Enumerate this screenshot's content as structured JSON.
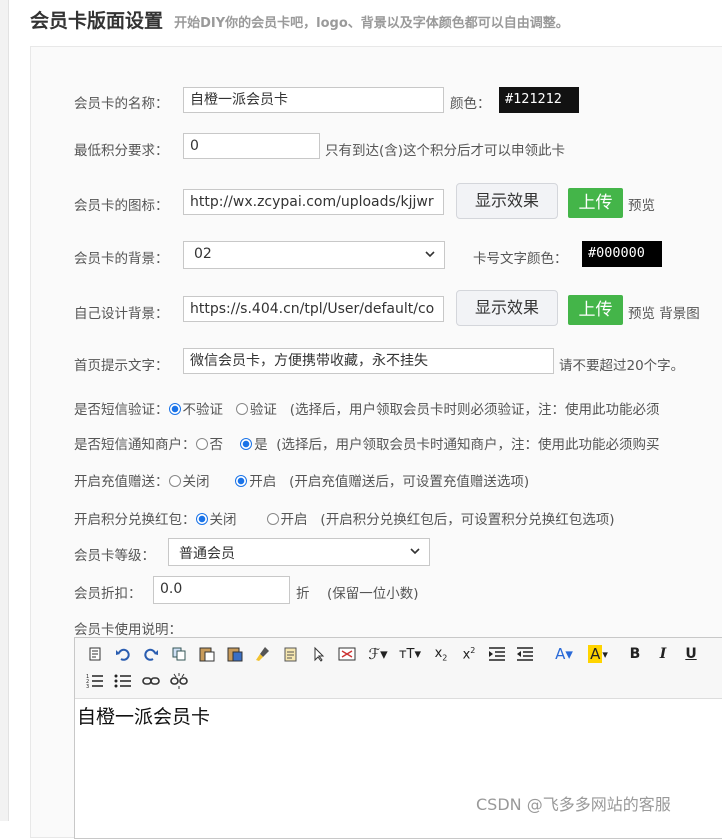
{
  "header": {
    "title": "会员卡版面设置",
    "subtitle": "开始DIY你的会员卡吧，logo、背景以及字体颜色都可以自由调整。"
  },
  "form": {
    "name_label": "会员卡的名称：",
    "name_value": "自橙一派会员卡",
    "color_label": "颜色：",
    "color_value": "#121212",
    "minpoints_label": "最低积分要求：",
    "minpoints_value": "0",
    "minpoints_hint": "只有到达(含)这个积分后才可以申领此卡",
    "icon_label": "会员卡的图标：",
    "icon_value": "http://wx.zcypai.com/uploads/kjjwr",
    "show_effect": "显示效果",
    "upload": "上传",
    "preview": "预览",
    "bg_label": "会员卡的背景：",
    "bg_value": "02",
    "cardno_color_label": "卡号文字颜色：",
    "cardno_color_value": "#000000",
    "custom_bg_label": "自己设计背景：",
    "custom_bg_value": "https://s.404.cn/tpl/User/default/co",
    "preview_bg": "预览 背景图",
    "tip_label": "首页提示文字：",
    "tip_value": "微信会员卡，方便携带收藏，永不挂失",
    "tip_hint": "请不要超过20个字。",
    "sms_verify_label": "是否短信验证：",
    "sms_verify_opt1": "不验证",
    "sms_verify_opt2": "验证",
    "sms_verify_hint": "(选择后，用户领取会员卡时则必须验证，注：使用此功能必须",
    "sms_notify_label": "是否短信通知商户：",
    "sms_notify_opt1": "否",
    "sms_notify_opt2": "是",
    "sms_notify_hint": "(选择后，用户领取会员卡时通知商户，注：使用此功能必须购买",
    "recharge_label": "开启充值赠送：",
    "recharge_opt1": "关闭",
    "recharge_opt2": "开启",
    "recharge_hint": "(开启充值赠送后，可设置充值赠送选项)",
    "redpack_label": "开启积分兑换红包：",
    "redpack_opt1": "关闭",
    "redpack_opt2": "开启",
    "redpack_hint": "(开启积分兑换红包后，可设置积分兑换红包选项)",
    "level_label": "会员卡等级：",
    "level_value": "普通会员",
    "discount_label": "会员折扣：",
    "discount_value": "0.0",
    "discount_unit": "折",
    "discount_hint": "(保留一位小数)",
    "desc_label": "会员卡使用说明："
  },
  "editor": {
    "toolbar": [
      "source-icon",
      "undo-icon",
      "redo-icon",
      "copy-icon",
      "paste-icon",
      "paste-word-icon",
      "brush-icon",
      "paste-text-icon",
      "select-icon",
      "preview-icon",
      "font-family-icon",
      "font-size-icon",
      "subscript-icon",
      "superscript-icon",
      "indent-icon",
      "outdent-icon",
      "font-color-icon",
      "bg-color-icon",
      "bold-icon",
      "italic-icon",
      "underline-icon",
      "ordered-list-icon",
      "unordered-list-icon",
      "link-icon",
      "unlink-icon"
    ],
    "content": "自橙一派会员卡"
  },
  "watermark": "CSDN @飞多多网站的客服"
}
